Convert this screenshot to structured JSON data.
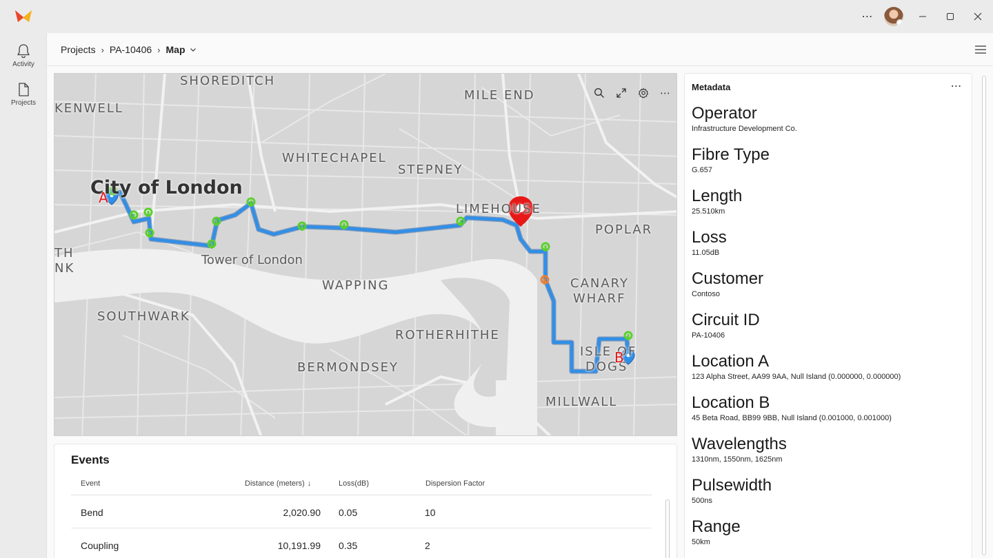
{
  "titlebar": {
    "more_label": "⋯"
  },
  "rail": {
    "items": [
      {
        "label": "Activity",
        "icon": "bell-icon"
      },
      {
        "label": "Projects",
        "icon": "document-icon"
      }
    ]
  },
  "breadcrumb": {
    "items": [
      "Projects",
      "PA-10406"
    ],
    "current": "Map"
  },
  "map": {
    "labels": {
      "shoreditch": "SHOREDITCH",
      "clerkenwell": "KENWELL",
      "mile_end": "MILE END",
      "whitechapel": "WHITECHAPEL",
      "stepney": "STEPNEY",
      "city_of_london": "City of London",
      "limehouse": "LIMEHOUSE",
      "poplar": "POPLAR",
      "tower_of_london": "Tower of London",
      "wapping": "WAPPING",
      "canary": "CANARY",
      "wharf": "WHARF",
      "southwark": "SOUTHWARK",
      "rotherhithe": "ROTHERHITHE",
      "isle": "ISLE OF",
      "dogs": "DOGS",
      "bermondsey": "BERMONDSEY",
      "millwall": "MILLWALL",
      "th": "TH",
      "nk": "NK",
      "point_a": "A",
      "point_b": "B"
    },
    "route_color": "#2f8fe8",
    "event_marker_color": "#66dd33",
    "warning_marker_color": "#f07f2b",
    "selected_marker_color": "#e81818"
  },
  "events": {
    "title": "Events",
    "columns": [
      "Event",
      "Distance (meters)",
      "Loss(dB)",
      "Dispersion Factor"
    ],
    "sort_indicator": "↓",
    "rows": [
      {
        "event": "Bend",
        "distance": "2,020.90",
        "loss": "0.05",
        "dispersion": "10"
      },
      {
        "event": "Coupling",
        "distance": "10,191.99",
        "loss": "0.35",
        "dispersion": "2"
      }
    ]
  },
  "metadata": {
    "title": "Metadata",
    "more_label": "⋯",
    "fields": [
      {
        "label": "Operator",
        "value": "Infrastructure Development Co."
      },
      {
        "label": "Fibre Type",
        "value": "G.657"
      },
      {
        "label": "Length",
        "value": "25.510km"
      },
      {
        "label": "Loss",
        "value": "11.05dB"
      },
      {
        "label": "Customer",
        "value": "Contoso"
      },
      {
        "label": "Circuit ID",
        "value": "PA-10406"
      },
      {
        "label": "Location A",
        "value": "123 Alpha Street, AA99 9AA, Null Island (0.000000, 0.000000)"
      },
      {
        "label": "Location B",
        "value": "45 Beta Road, BB99 9BB, Null Island (0.001000, 0.001000)"
      },
      {
        "label": "Wavelengths",
        "value": "1310nm, 1550nm, 1625nm"
      },
      {
        "label": "Pulsewidth",
        "value": "500ns"
      },
      {
        "label": "Range",
        "value": "50km"
      }
    ]
  }
}
